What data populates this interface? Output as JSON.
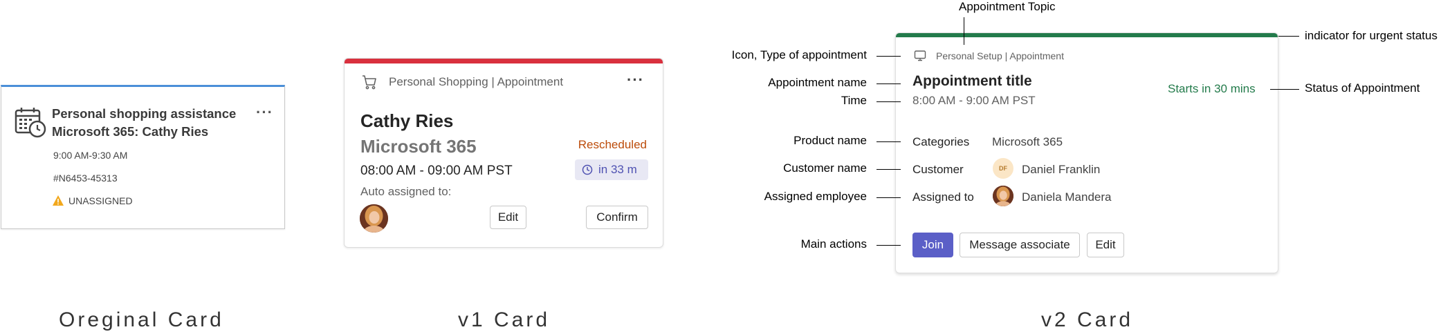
{
  "original_card": {
    "title_line1": "Personal shopping assistance",
    "title_line2": "Microsoft 365: Cathy Ries",
    "time": "9:00 AM-9:30 AM",
    "id": "#N6453-45313",
    "status": "UNASSIGNED",
    "more": "···",
    "accent": "#4a8fd8"
  },
  "v1_card": {
    "type_label": "Personal Shopping | Appointment",
    "more": "···",
    "customer_name": "Cathy Ries",
    "product": "Microsoft 365",
    "status": "Rescheduled",
    "time": "08:00 AM - 09:00 AM PST",
    "countdown": "in 33 m",
    "auto_assigned": "Auto assigned to:",
    "edit_label": "Edit",
    "confirm_label": "Confirm",
    "accent": "#d9303e"
  },
  "v2_card": {
    "type_label": "Personal Setup | Appointment",
    "title": "Appointment title",
    "time": "8:00 AM - 9:00 AM PST",
    "status": "Starts in 30 mins",
    "categories_label": "Categories",
    "categories_value": "Microsoft 365",
    "customer_label": "Customer",
    "customer_initials": "DF",
    "customer_value": "Daniel Franklin",
    "assigned_label": "Assigned to",
    "assigned_value": "Daniela Mandera",
    "join_label": "Join",
    "message_label": "Message associate",
    "edit_label": "Edit",
    "accent": "#237b4b"
  },
  "callouts": {
    "topic": "Appointment Topic",
    "urgent": "indicator for urgent status",
    "icon_type": "Icon, Type of appointment",
    "name": "Appointment name",
    "time": "Time",
    "status": "Status of Appointment",
    "product": "Product name",
    "customer": "Customer name",
    "assigned": "Assigned employee",
    "actions": "Main actions"
  },
  "captions": {
    "original": "Oreginal Card",
    "v1": "v1 Card",
    "v2": "v2 Card"
  }
}
